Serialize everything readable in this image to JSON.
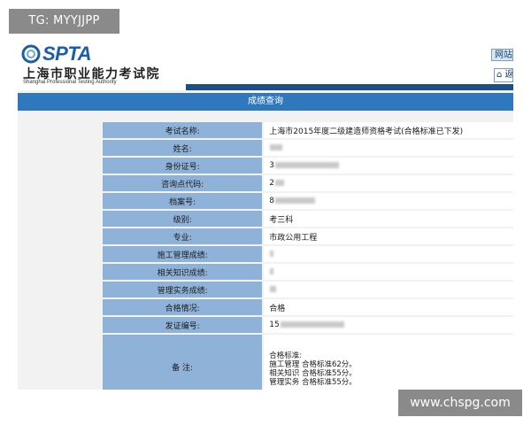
{
  "watermarks": {
    "top": "TG: MYYJJPP",
    "bottom": "www.chspg.com"
  },
  "header": {
    "logo_text": "SPTA",
    "org_name_cn": "上海市职业能力考试院",
    "org_name_en": "Shanghai Professional Testing Authority",
    "nav_label": "网站首",
    "home_label": "⌂ 返"
  },
  "page_title": "成绩查询",
  "colors": {
    "label_cell": "#8fb2d9",
    "title_bar": "#2f78bd",
    "header_stripe": "#1c4f86",
    "logo_blue": "#1a5ea8"
  },
  "results": [
    {
      "label": "考试名称:",
      "value": "上海市2015年度二级建造师资格考试(合格标准已下发)",
      "redacted": false
    },
    {
      "label": "姓名:",
      "value": "",
      "redacted": true,
      "blur_width": 14
    },
    {
      "label": "身份证号:",
      "value": "3",
      "redacted": true,
      "blur_width": 72
    },
    {
      "label": "咨询点代码:",
      "value": "2",
      "redacted": true,
      "blur_width": 10
    },
    {
      "label": "档案号:",
      "value": "8",
      "redacted": true,
      "blur_width": 45
    },
    {
      "label": "级别:",
      "value": "考三科",
      "redacted": false
    },
    {
      "label": "专业:",
      "value": "市政公用工程",
      "redacted": false
    },
    {
      "label": "施工管理成绩:",
      "value": "",
      "redacted": true,
      "blur_width": 4
    },
    {
      "label": "相关知识成绩:",
      "value": "",
      "redacted": true,
      "blur_width": 4
    },
    {
      "label": "管理实务成绩:",
      "value": "",
      "redacted": true,
      "blur_width": 7
    },
    {
      "label": "合格情况:",
      "value": "合格",
      "redacted": false
    },
    {
      "label": "发证编号:",
      "value": "15",
      "redacted": true,
      "blur_width": 72
    }
  ],
  "remarks": {
    "label": "备 注:",
    "lines": [
      "合格标准:",
      "施工管理 合格标准62分。",
      "相关知识 合格标准55分。",
      "管理实务 合格标准55分。"
    ]
  }
}
